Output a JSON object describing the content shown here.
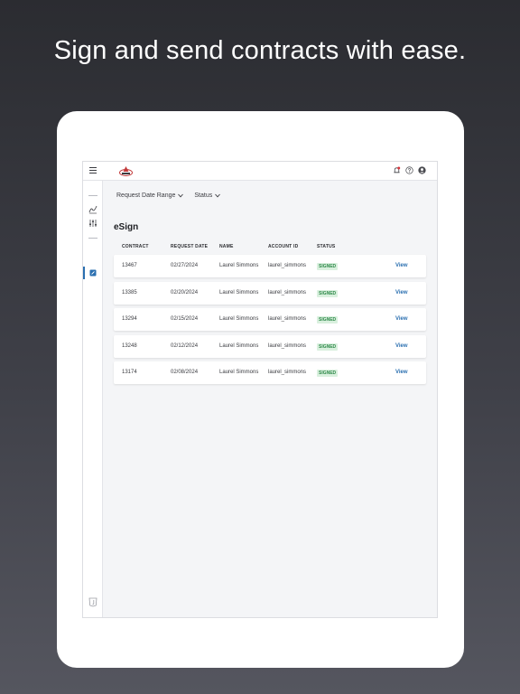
{
  "headline": "Sign and send contracts with ease.",
  "colors": {
    "accent": "#2a6fb0",
    "signed_text": "#2f8a4a",
    "signed_bg": "#d9f0de",
    "notification_dot": "#d8323a"
  },
  "topbar": {
    "menu_icon": "hamburger-icon",
    "logo": "brand-logo",
    "icons": [
      "notification-bell-icon",
      "help-icon",
      "user-avatar-icon"
    ]
  },
  "sidebar": {
    "items": [
      {
        "icon": "signature-icon",
        "active": false
      },
      {
        "icon": "sliders-icon",
        "active": false
      },
      {
        "icon": "edit-document-icon",
        "active": true
      }
    ],
    "footer_icon": "javascript-icon"
  },
  "filters": {
    "date_range": "Request Date Range",
    "status": "Status"
  },
  "page_title": "eSign",
  "table": {
    "headers": {
      "contract": "CONTRACT",
      "request_date": "REQUEST DATE",
      "name": "NAME",
      "account_id": "ACCOUNT ID",
      "status": "STATUS"
    },
    "rows": [
      {
        "contract": "13467",
        "request_date": "02/27/2024",
        "name": "Laurel Simmons",
        "account_id": "laurel_simmons",
        "status": "SIGNED",
        "action": "View"
      },
      {
        "contract": "13385",
        "request_date": "02/20/2024",
        "name": "Laurel Simmons",
        "account_id": "laurel_simmons",
        "status": "SIGNED",
        "action": "View"
      },
      {
        "contract": "13294",
        "request_date": "02/15/2024",
        "name": "Laurel Simmons",
        "account_id": "laurel_simmons",
        "status": "SIGNED",
        "action": "View"
      },
      {
        "contract": "13248",
        "request_date": "02/12/2024",
        "name": "Laurel Simmons",
        "account_id": "laurel_simmons",
        "status": "SIGNED",
        "action": "View"
      },
      {
        "contract": "13174",
        "request_date": "02/08/2024",
        "name": "Laurel Simmons",
        "account_id": "laurel_simmons",
        "status": "SIGNED",
        "action": "View"
      }
    ]
  }
}
